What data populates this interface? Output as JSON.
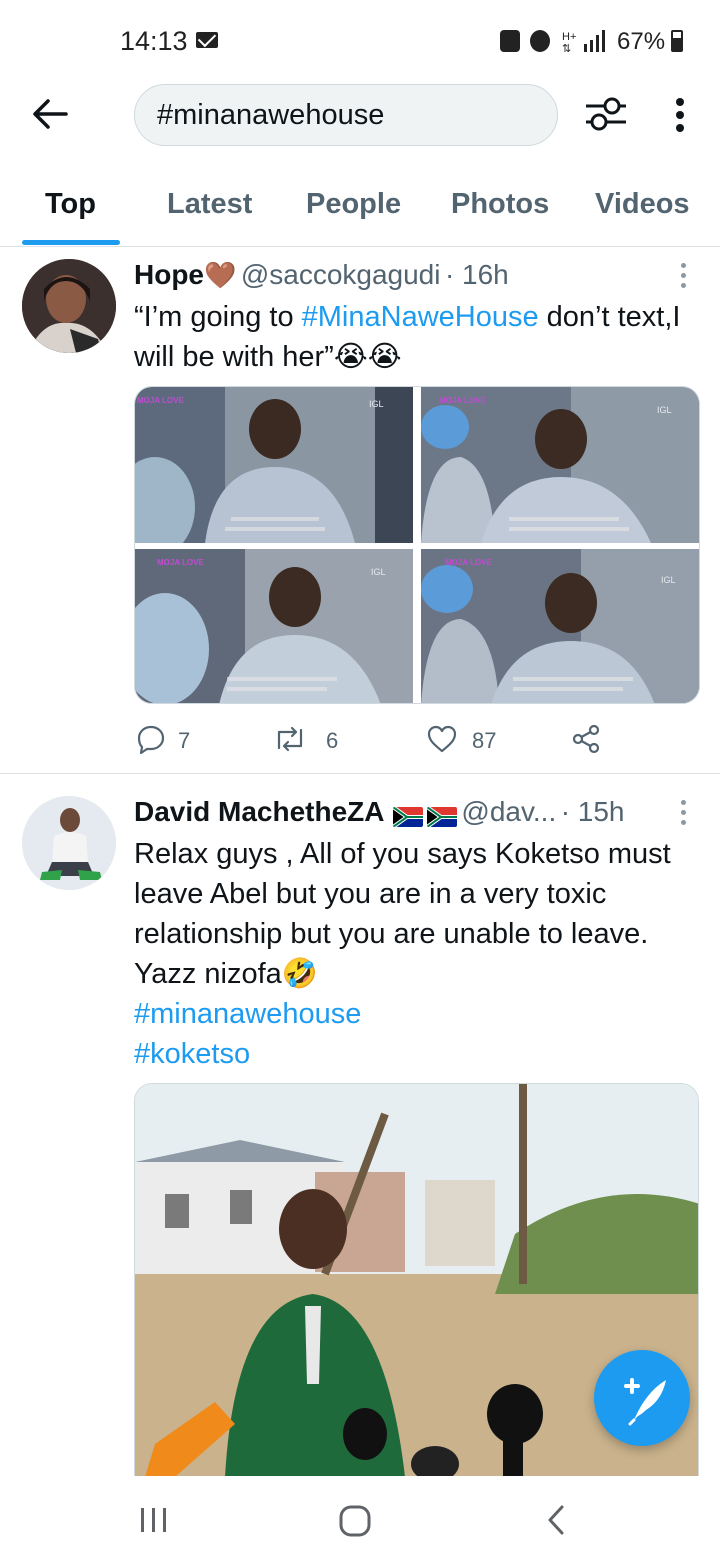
{
  "status_bar": {
    "time": "14:13",
    "battery": "67%",
    "battery_level": 0.67
  },
  "search": {
    "query": "#minanawehouse"
  },
  "tabs": [
    {
      "label": "Top",
      "active": true
    },
    {
      "label": "Latest",
      "active": false
    },
    {
      "label": "People",
      "active": false
    },
    {
      "label": "Photos",
      "active": false
    },
    {
      "label": "Videos",
      "active": false
    }
  ],
  "tweets": [
    {
      "name": "Hope",
      "name_emoji": "🤎",
      "handle": "@saccokgagudi",
      "time": "· 16h",
      "text_parts": [
        "“I’m going to ",
        "#MinaNaweHouse",
        " don’t text,I will be with her”",
        "😭😭"
      ],
      "media_label": "IGL",
      "media_badge": "MOJA LOVE",
      "actions": {
        "replies": "7",
        "retweets": "6",
        "likes": "87"
      }
    },
    {
      "name": "David MachetheZA",
      "handle": "@dav...",
      "time": "· 15h",
      "text": "Relax guys , All of you says Koketso must leave Abel but you are in a very toxic relationship but you are unable to leave.",
      "text_line2": "Yazz nizofa",
      "text_emoji": "🤣",
      "hashtags": [
        "#minanawehouse",
        "#koketso"
      ]
    }
  ],
  "colors": {
    "accent": "#1d9bf0",
    "text": "#0f1419",
    "muted": "#536471"
  }
}
